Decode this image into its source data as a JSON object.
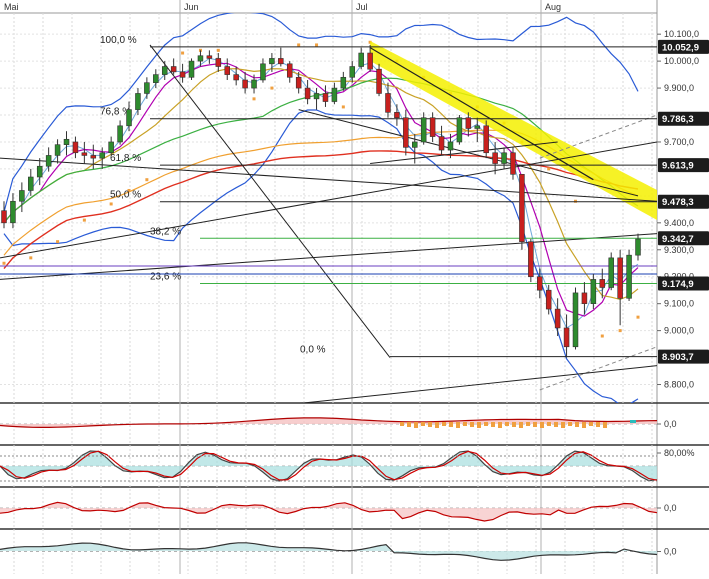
{
  "chart_data": [
    {
      "type": "candlestick",
      "title": "",
      "months": [
        "Mai",
        "Jun",
        "Jul",
        "Aug"
      ],
      "yticks": [
        "10.100,0",
        "10.000,0",
        "9.900,0",
        "9.700,0",
        "9.400,0",
        "9.300,0",
        "9.200,0",
        "9.100,0",
        "9.000,0",
        "8.800,0"
      ],
      "ylim": [
        8750,
        10160
      ],
      "price_boxes": [
        {
          "label": "10.052,9",
          "value": 10052.9
        },
        {
          "label": "9.786,3",
          "value": 9786.3
        },
        {
          "label": "9.613,9",
          "value": 9613.9
        },
        {
          "label": "9.478,3",
          "value": 9478.3
        },
        {
          "label": "9.342,7",
          "value": 9342.7
        },
        {
          "label": "9.174,9",
          "value": 9174.9
        },
        {
          "label": "8.903,7",
          "value": 8903.7
        }
      ],
      "fib_levels": [
        {
          "label": "100,0 %",
          "value": 10052.9
        },
        {
          "label": "76,8 %",
          "value": 9786.3
        },
        {
          "label": "61,8 %",
          "value": 9613.9
        },
        {
          "label": "50,0 %",
          "value": 9478.3
        },
        {
          "label": "38,2 %",
          "value": 9342.7
        },
        {
          "label": "23,6 %",
          "value": 9174.9
        },
        {
          "label": "0,0 %",
          "value": 8903.7
        }
      ],
      "candles": [
        [
          9445,
          9480,
          9380,
          9400
        ],
        [
          9400,
          9510,
          9380,
          9480
        ],
        [
          9480,
          9550,
          9440,
          9520
        ],
        [
          9520,
          9600,
          9500,
          9570
        ],
        [
          9570,
          9640,
          9540,
          9610
        ],
        [
          9610,
          9680,
          9590,
          9650
        ],
        [
          9650,
          9710,
          9620,
          9690
        ],
        [
          9690,
          9740,
          9650,
          9710
        ],
        [
          9700,
          9720,
          9640,
          9660
        ],
        [
          9660,
          9700,
          9620,
          9650
        ],
        [
          9650,
          9690,
          9600,
          9640
        ],
        [
          9640,
          9680,
          9600,
          9660
        ],
        [
          9660,
          9720,
          9650,
          9700
        ],
        [
          9700,
          9780,
          9690,
          9760
        ],
        [
          9760,
          9850,
          9740,
          9820
        ],
        [
          9820,
          9900,
          9800,
          9880
        ],
        [
          9880,
          9940,
          9860,
          9920
        ],
        [
          9920,
          9970,
          9900,
          9950
        ],
        [
          9950,
          10000,
          9930,
          9980
        ],
        [
          9980,
          10010,
          9950,
          9960
        ],
        [
          9960,
          9990,
          9920,
          9940
        ],
        [
          9940,
          10010,
          9930,
          10000
        ],
        [
          10000,
          10040,
          9980,
          10020
        ],
        [
          10020,
          10040,
          9990,
          10010
        ],
        [
          10010,
          10030,
          9960,
          9980
        ],
        [
          9980,
          10010,
          9930,
          9950
        ],
        [
          9950,
          9980,
          9910,
          9930
        ],
        [
          9930,
          9960,
          9880,
          9900
        ],
        [
          9900,
          9950,
          9880,
          9930
        ],
        [
          9930,
          10010,
          9920,
          9990
        ],
        [
          9990,
          10030,
          9960,
          10010
        ],
        [
          10010,
          10050,
          9980,
          9990
        ],
        [
          9990,
          10000,
          9920,
          9940
        ],
        [
          9940,
          9960,
          9880,
          9900
        ],
        [
          9900,
          9930,
          9840,
          9860
        ],
        [
          9860,
          9900,
          9820,
          9880
        ],
        [
          9880,
          9910,
          9830,
          9850
        ],
        [
          9850,
          9920,
          9840,
          9900
        ],
        [
          9900,
          9960,
          9890,
          9940
        ],
        [
          9940,
          10000,
          9920,
          9980
        ],
        [
          9980,
          10050,
          9970,
          10030
        ],
        [
          10030,
          10060,
          9960,
          9970
        ],
        [
          9970,
          9990,
          9870,
          9880
        ],
        [
          9880,
          9920,
          9790,
          9810
        ],
        [
          9810,
          9840,
          9760,
          9790
        ],
        [
          9790,
          9820,
          9650,
          9680
        ],
        [
          9680,
          9730,
          9620,
          9700
        ],
        [
          9700,
          9810,
          9690,
          9790
        ],
        [
          9790,
          9810,
          9700,
          9720
        ],
        [
          9720,
          9760,
          9650,
          9670
        ],
        [
          9670,
          9730,
          9640,
          9700
        ],
        [
          9700,
          9800,
          9690,
          9790
        ],
        [
          9790,
          9810,
          9720,
          9750
        ],
        [
          9750,
          9790,
          9700,
          9760
        ],
        [
          9760,
          9780,
          9640,
          9660
        ],
        [
          9660,
          9700,
          9580,
          9620
        ],
        [
          9620,
          9680,
          9600,
          9660
        ],
        [
          9660,
          9680,
          9560,
          9580
        ],
        [
          9580,
          9560,
          9300,
          9330
        ],
        [
          9330,
          9340,
          9180,
          9200
        ],
        [
          9200,
          9230,
          9120,
          9150
        ],
        [
          9150,
          9170,
          9060,
          9080
        ],
        [
          9080,
          9120,
          8980,
          9010
        ],
        [
          9010,
          9060,
          8900,
          8940
        ],
        [
          8940,
          9160,
          8930,
          9140
        ],
        [
          9140,
          9180,
          9060,
          9100
        ],
        [
          9100,
          9210,
          9080,
          9190
        ],
        [
          9190,
          9230,
          9120,
          9160
        ],
        [
          9160,
          9290,
          9150,
          9270
        ],
        [
          9270,
          9300,
          9020,
          9120
        ],
        [
          9120,
          9300,
          9110,
          9280
        ],
        [
          9280,
          9360,
          9260,
          9340
        ]
      ],
      "indicators": [
        {
          "label": "0,0"
        },
        {
          "label": "80,00%"
        },
        {
          "label": "0,0"
        },
        {
          "label": "0,0"
        }
      ]
    }
  ]
}
